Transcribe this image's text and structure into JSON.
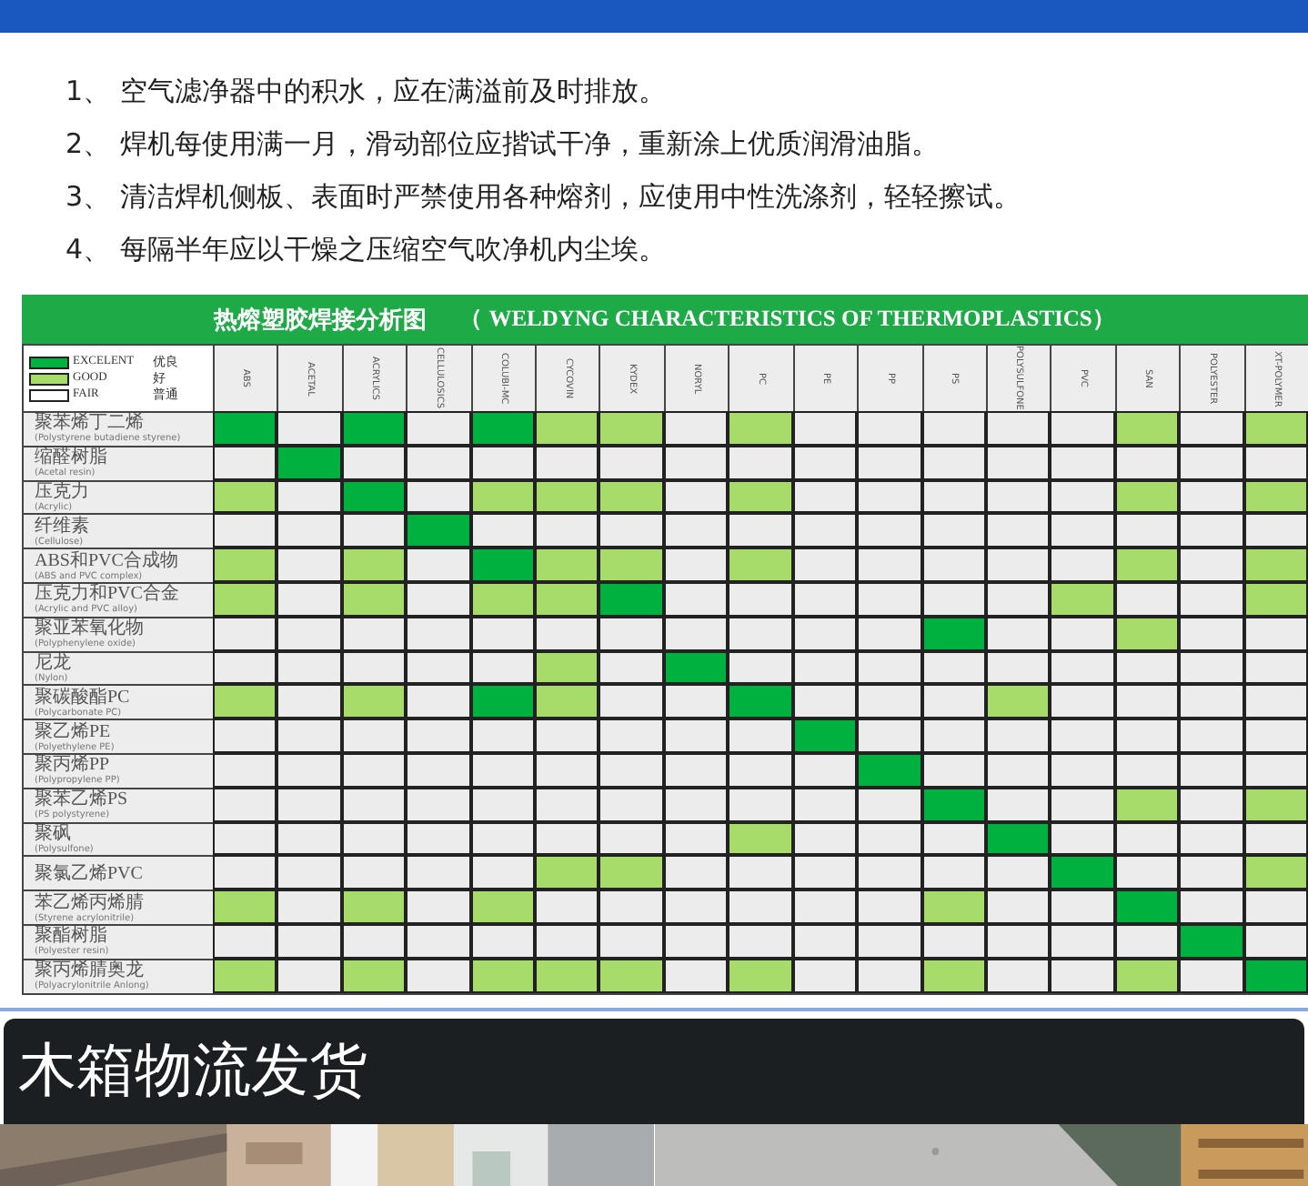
{
  "tips": [
    {
      "number": "1、",
      "text": "空气滤净器中的积水，应在满溢前及时排放。"
    },
    {
      "number": "2、",
      "text": "焊机每使用满一月，滑动部位应揩试干净，重新涂上优质润滑油脂。"
    },
    {
      "number": "3、",
      "text": "清洁焊机侧板、表面时严禁使用各种熔剂，应使用中性洗涤剂，轻轻擦试。"
    },
    {
      "number": "4、",
      "text": "每隔半年应以干燥之压缩空气吹净机内尘埃。"
    }
  ],
  "chart": {
    "title": "热熔塑胶焊接分析图",
    "title_en": "（ WELDYNG CHARACTERISTICS OF THERMOPLASTICS）",
    "legend": [
      {
        "color": "#00b140",
        "label": "EXCELENT",
        "label_cn": "优良"
      },
      {
        "color": "#a8dc6a",
        "label": "GOOD",
        "label_cn": "好"
      },
      {
        "color": "#ffffff",
        "label": "FAIR",
        "label_cn": "普通"
      }
    ],
    "columns": [
      "ABS",
      "ACETAL",
      "ACRYLICS",
      "CELLULOSICS",
      "COLUBI-MC",
      "CYCOVIN",
      "KYDEX",
      "NORYL",
      "PC",
      "PE",
      "PP",
      "PS",
      "POLYSULFONE",
      "PVC",
      "SAN",
      "POLYESTER",
      "XT-POLYMER"
    ],
    "rows": [
      {
        "label": "聚苯烯丁二烯",
        "sub": "(Polystyrene butadiene styrene)",
        "cells": [
          {
            "color": "#00b140"
          },
          {
            "color": "#ececec"
          },
          {
            "color": "#00b140"
          },
          {
            "color": "#ececec"
          },
          {
            "color": "#00b140"
          },
          {
            "color": "#a8dc6a"
          },
          {
            "color": "#a8dc6a"
          },
          {
            "color": "#ececec"
          },
          {
            "color": "#a8dc6a"
          },
          {
            "color": "#ececec"
          },
          {
            "color": "#ececec"
          },
          {
            "color": "#ececec"
          },
          {
            "color": "#ececec"
          },
          {
            "color": "#ececec"
          },
          {
            "color": "#a8dc6a"
          },
          {
            "color": "#ececec"
          },
          {
            "color": "#a8dc6a"
          }
        ]
      },
      {
        "label": "缩醛树脂",
        "sub": "(Acetal resin)",
        "cells": [
          {
            "color": "#ececec"
          },
          {
            "color": "#00b140"
          },
          {
            "color": "#ececec"
          },
          {
            "color": "#ececec"
          },
          {
            "color": "#ececec"
          },
          {
            "color": "#ececec"
          },
          {
            "color": "#ececec"
          },
          {
            "color": "#ececec"
          },
          {
            "color": "#ececec"
          },
          {
            "color": "#ececec"
          },
          {
            "color": "#ececec"
          },
          {
            "color": "#ececec"
          },
          {
            "color": "#ececec"
          },
          {
            "color": "#ececec"
          },
          {
            "color": "#ececec"
          },
          {
            "color": "#ececec"
          },
          {
            "color": "#ececec"
          }
        ]
      },
      {
        "label": "压克力",
        "sub": "(Acrylic)",
        "cells": [
          {
            "color": "#a8dc6a"
          },
          {
            "color": "#ececec"
          },
          {
            "color": "#00b140"
          },
          {
            "color": "#ececec"
          },
          {
            "color": "#a8dc6a"
          },
          {
            "color": "#a8dc6a"
          },
          {
            "color": "#a8dc6a"
          },
          {
            "color": "#ececec"
          },
          {
            "color": "#a8dc6a"
          },
          {
            "color": "#ececec"
          },
          {
            "color": "#ececec"
          },
          {
            "color": "#ececec"
          },
          {
            "color": "#ececec"
          },
          {
            "color": "#ececec"
          },
          {
            "color": "#a8dc6a"
          },
          {
            "color": "#ececec"
          },
          {
            "color": "#a8dc6a"
          }
        ]
      },
      {
        "label": "纤维素",
        "sub": "(Cellulose)",
        "cells": [
          {
            "color": "#ececec"
          },
          {
            "color": "#ececec"
          },
          {
            "color": "#ececec"
          },
          {
            "color": "#00b140"
          },
          {
            "color": "#ececec"
          },
          {
            "color": "#ececec"
          },
          {
            "color": "#ececec"
          },
          {
            "color": "#ececec"
          },
          {
            "color": "#ececec"
          },
          {
            "color": "#ececec"
          },
          {
            "color": "#ececec"
          },
          {
            "color": "#ececec"
          },
          {
            "color": "#ececec"
          },
          {
            "color": "#ececec"
          },
          {
            "color": "#ececec"
          },
          {
            "color": "#ececec"
          },
          {
            "color": "#ececec"
          }
        ]
      },
      {
        "label": "ABS和PVC合成物",
        "sub": "(ABS and PVC complex)",
        "cells": [
          {
            "color": "#a8dc6a"
          },
          {
            "color": "#ececec"
          },
          {
            "color": "#a8dc6a"
          },
          {
            "color": "#ececec"
          },
          {
            "color": "#00b140"
          },
          {
            "color": "#a8dc6a"
          },
          {
            "color": "#a8dc6a"
          },
          {
            "color": "#ececec"
          },
          {
            "color": "#a8dc6a"
          },
          {
            "color": "#ececec"
          },
          {
            "color": "#ececec"
          },
          {
            "color": "#ececec"
          },
          {
            "color": "#ececec"
          },
          {
            "color": "#ececec"
          },
          {
            "color": "#a8dc6a"
          },
          {
            "color": "#ececec"
          },
          {
            "color": "#a8dc6a"
          }
        ]
      },
      {
        "label": "压克力和PVC合金",
        "sub": "(Acrylic and PVC alloy)",
        "cells": [
          {
            "color": "#a8dc6a"
          },
          {
            "color": "#ececec"
          },
          {
            "color": "#a8dc6a"
          },
          {
            "color": "#ececec"
          },
          {
            "color": "#a8dc6a"
          },
          {
            "color": "#a8dc6a"
          },
          {
            "color": "#00b140"
          },
          {
            "color": "#ececec"
          },
          {
            "color": "#ececec"
          },
          {
            "color": "#ececec"
          },
          {
            "color": "#ececec"
          },
          {
            "color": "#ececec"
          },
          {
            "color": "#ececec"
          },
          {
            "color": "#a8dc6a"
          },
          {
            "color": "#ececec"
          },
          {
            "color": "#ececec"
          },
          {
            "color": "#a8dc6a"
          }
        ]
      },
      {
        "label": "聚亚苯氧化物",
        "sub": "(Polyphenylene oxide)",
        "cells": [
          {
            "color": "#ececec"
          },
          {
            "color": "#ececec"
          },
          {
            "color": "#ececec"
          },
          {
            "color": "#ececec"
          },
          {
            "color": "#ececec"
          },
          {
            "color": "#ececec"
          },
          {
            "color": "#ececec"
          },
          {
            "color": "#ececec"
          },
          {
            "color": "#ececec"
          },
          {
            "color": "#ececec"
          },
          {
            "color": "#ececec"
          },
          {
            "color": "#00b140"
          },
          {
            "color": "#ececec"
          },
          {
            "color": "#ececec"
          },
          {
            "color": "#a8dc6a"
          },
          {
            "color": "#ececec"
          },
          {
            "color": "#ececec"
          }
        ]
      },
      {
        "label": "尼龙",
        "sub": "(Nylon)",
        "cells": [
          {
            "color": "#ececec"
          },
          {
            "color": "#ececec"
          },
          {
            "color": "#ececec"
          },
          {
            "color": "#ececec"
          },
          {
            "color": "#ececec"
          },
          {
            "color": "#a8dc6a"
          },
          {
            "color": "#ececec"
          },
          {
            "color": "#00b140"
          },
          {
            "color": "#ececec"
          },
          {
            "color": "#ececec"
          },
          {
            "color": "#ececec"
          },
          {
            "color": "#ececec"
          },
          {
            "color": "#ececec"
          },
          {
            "color": "#ececec"
          },
          {
            "color": "#ececec"
          },
          {
            "color": "#ececec"
          },
          {
            "color": "#ececec"
          }
        ]
      },
      {
        "label": "聚碳酸酯PC",
        "sub": "(Polycarbonate PC)",
        "cells": [
          {
            "color": "#a8dc6a"
          },
          {
            "color": "#ececec"
          },
          {
            "color": "#a8dc6a"
          },
          {
            "color": "#ececec"
          },
          {
            "color": "#00b140"
          },
          {
            "color": "#a8dc6a"
          },
          {
            "color": "#ececec"
          },
          {
            "color": "#ececec"
          },
          {
            "color": "#00b140"
          },
          {
            "color": "#ececec"
          },
          {
            "color": "#ececec"
          },
          {
            "color": "#ececec"
          },
          {
            "color": "#a8dc6a"
          },
          {
            "color": "#ececec"
          },
          {
            "color": "#ececec"
          },
          {
            "color": "#ececec"
          },
          {
            "color": "#ececec"
          }
        ]
      },
      {
        "label": "聚乙烯PE",
        "sub": "(Polyethylene PE)",
        "cells": [
          {
            "color": "#ececec"
          },
          {
            "color": "#ececec"
          },
          {
            "color": "#ececec"
          },
          {
            "color": "#ececec"
          },
          {
            "color": "#ececec"
          },
          {
            "color": "#ececec"
          },
          {
            "color": "#ececec"
          },
          {
            "color": "#ececec"
          },
          {
            "color": "#ececec"
          },
          {
            "color": "#00b140"
          },
          {
            "color": "#ececec"
          },
          {
            "color": "#ececec"
          },
          {
            "color": "#ececec"
          },
          {
            "color": "#ececec"
          },
          {
            "color": "#ececec"
          },
          {
            "color": "#ececec"
          },
          {
            "color": "#ececec"
          }
        ]
      },
      {
        "label": "聚丙烯PP",
        "sub": "(Polypropylene PP)",
        "cells": [
          {
            "color": "#ececec"
          },
          {
            "color": "#ececec"
          },
          {
            "color": "#ececec"
          },
          {
            "color": "#ececec"
          },
          {
            "color": "#ececec"
          },
          {
            "color": "#ececec"
          },
          {
            "color": "#ececec"
          },
          {
            "color": "#ececec"
          },
          {
            "color": "#ececec"
          },
          {
            "color": "#ececec"
          },
          {
            "color": "#00b140"
          },
          {
            "color": "#ececec"
          },
          {
            "color": "#ececec"
          },
          {
            "color": "#ececec"
          },
          {
            "color": "#ececec"
          },
          {
            "color": "#ececec"
          },
          {
            "color": "#ececec"
          }
        ]
      },
      {
        "label": "聚苯乙烯PS",
        "sub": "(PS polystyrene)",
        "cells": [
          {
            "color": "#ececec"
          },
          {
            "color": "#ececec"
          },
          {
            "color": "#ececec"
          },
          {
            "color": "#ececec"
          },
          {
            "color": "#ececec"
          },
          {
            "color": "#ececec"
          },
          {
            "color": "#ececec"
          },
          {
            "color": "#ececec"
          },
          {
            "color": "#ececec"
          },
          {
            "color": "#ececec"
          },
          {
            "color": "#ececec"
          },
          {
            "color": "#00b140"
          },
          {
            "color": "#ececec"
          },
          {
            "color": "#ececec"
          },
          {
            "color": "#a8dc6a"
          },
          {
            "color": "#ececec"
          },
          {
            "color": "#a8dc6a"
          }
        ]
      },
      {
        "label": "聚砜",
        "sub": "(Polysulfone)",
        "cells": [
          {
            "color": "#ececec"
          },
          {
            "color": "#ececec"
          },
          {
            "color": "#ececec"
          },
          {
            "color": "#ececec"
          },
          {
            "color": "#ececec"
          },
          {
            "color": "#ececec"
          },
          {
            "color": "#ececec"
          },
          {
            "color": "#ececec"
          },
          {
            "color": "#a8dc6a"
          },
          {
            "color": "#ececec"
          },
          {
            "color": "#ececec"
          },
          {
            "color": "#ececec"
          },
          {
            "color": "#00b140"
          },
          {
            "color": "#ececec"
          },
          {
            "color": "#ececec"
          },
          {
            "color": "#ececec"
          },
          {
            "color": "#ececec"
          }
        ]
      },
      {
        "label": "聚氯乙烯PVC",
        "cells": [
          {
            "color": "#ececec"
          },
          {
            "color": "#ececec"
          },
          {
            "color": "#ececec"
          },
          {
            "color": "#ececec"
          },
          {
            "color": "#ececec"
          },
          {
            "color": "#a8dc6a"
          },
          {
            "color": "#a8dc6a"
          },
          {
            "color": "#ececec"
          },
          {
            "color": "#ececec"
          },
          {
            "color": "#ececec"
          },
          {
            "color": "#ececec"
          },
          {
            "color": "#ececec"
          },
          {
            "color": "#ececec"
          },
          {
            "color": "#00b140"
          },
          {
            "color": "#ececec"
          },
          {
            "color": "#ececec"
          },
          {
            "color": "#a8dc6a"
          }
        ]
      },
      {
        "label": "苯乙烯丙烯腈",
        "sub": "(Styrene acrylonitrile)",
        "cells": [
          {
            "color": "#a8dc6a"
          },
          {
            "color": "#ececec"
          },
          {
            "color": "#a8dc6a"
          },
          {
            "color": "#ececec"
          },
          {
            "color": "#a8dc6a"
          },
          {
            "color": "#ececec"
          },
          {
            "color": "#ececec"
          },
          {
            "color": "#ececec"
          },
          {
            "color": "#ececec"
          },
          {
            "color": "#ececec"
          },
          {
            "color": "#ececec"
          },
          {
            "color": "#a8dc6a"
          },
          {
            "color": "#ececec"
          },
          {
            "color": "#ececec"
          },
          {
            "color": "#00b140"
          },
          {
            "color": "#ececec"
          },
          {
            "color": "#ececec"
          }
        ]
      },
      {
        "label": "聚酯树脂",
        "sub": "(Polyester resin)",
        "cells": [
          {
            "color": "#ececec"
          },
          {
            "color": "#ececec"
          },
          {
            "color": "#ececec"
          },
          {
            "color": "#ececec"
          },
          {
            "color": "#ececec"
          },
          {
            "color": "#ececec"
          },
          {
            "color": "#ececec"
          },
          {
            "color": "#ececec"
          },
          {
            "color": "#ececec"
          },
          {
            "color": "#ececec"
          },
          {
            "color": "#ececec"
          },
          {
            "color": "#ececec"
          },
          {
            "color": "#ececec"
          },
          {
            "color": "#ececec"
          },
          {
            "color": "#ececec"
          },
          {
            "color": "#00b140"
          },
          {
            "color": "#ececec"
          }
        ]
      },
      {
        "label": "聚丙烯腈奥龙",
        "sub": "(Polyacrylonitrile Anlong)",
        "cells": [
          {
            "color": "#a8dc6a"
          },
          {
            "color": "#ececec"
          },
          {
            "color": "#a8dc6a"
          },
          {
            "color": "#ececec"
          },
          {
            "color": "#a8dc6a"
          },
          {
            "color": "#a8dc6a"
          },
          {
            "color": "#a8dc6a"
          },
          {
            "color": "#ececec"
          },
          {
            "color": "#a8dc6a"
          },
          {
            "color": "#ececec"
          },
          {
            "color": "#ececec"
          },
          {
            "color": "#a8dc6a"
          },
          {
            "color": "#ececec"
          },
          {
            "color": "#ececec"
          },
          {
            "color": "#a8dc6a"
          },
          {
            "color": "#ececec"
          },
          {
            "color": "#00b140"
          }
        ]
      }
    ]
  },
  "banner": {
    "title": "木箱物流发货"
  }
}
